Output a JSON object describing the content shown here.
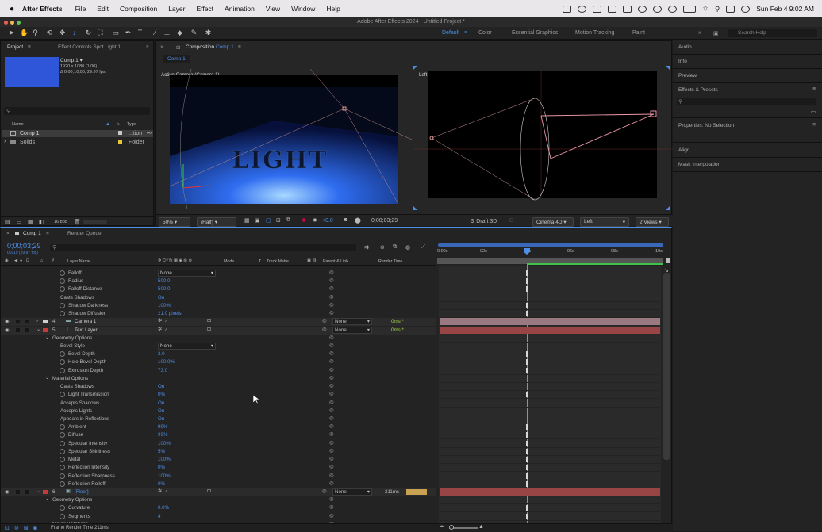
{
  "menubar": {
    "app": "After Effects",
    "items": [
      "File",
      "Edit",
      "Composition",
      "Layer",
      "Effect",
      "Animation",
      "View",
      "Window",
      "Help"
    ],
    "clock": "Sun Feb 4  9:02 AM"
  },
  "window_title": "Adobe After Effects 2024 - Untitled Project *",
  "workspaces": [
    "Default",
    "Color",
    "Essential Graphics",
    "Motion Tracking",
    "Paint"
  ],
  "search_help": "Search Help",
  "project": {
    "tab": "Project",
    "effect_tab": "Effect Controls Spot Light 1",
    "comp_name": "Comp 1 ▾",
    "comp_res": "1920 x 1080 (1.00)",
    "comp_dur": "Δ 0;00;10;00, 29.97 fps",
    "col_name": "Name",
    "col_type": "Type",
    "items": [
      {
        "name": "Comp 1",
        "type": "...tion"
      },
      {
        "name": "Solids",
        "type": "Folder"
      }
    ],
    "bpc": "16 bpc"
  },
  "composition": {
    "tab": "Composition",
    "tab_comp": "Comp 1",
    "crumb": "Comp 1",
    "view_left": "Active Camera (Camera 1)",
    "view_right": "Left",
    "logo_text": "LIGHT",
    "zoom": "50%",
    "resolution": "(Half)",
    "exposure": "+0.0",
    "timecode": "0;00;03;29",
    "draft": "Draft 3D",
    "renderer": "Cinema 4D",
    "view3d": "Left",
    "views": "2 Views"
  },
  "right_panels": [
    "Audio",
    "Info",
    "Preview",
    "Effects & Presets",
    "Properties: No Selection",
    "Align",
    "Mask Interpolation"
  ],
  "timeline": {
    "tab": "Comp 1",
    "render_queue": "Render Queue",
    "timecode": "0;00;03;29",
    "fps_sub": "00119 (29.97 fps)",
    "col_layer": "Layer Name",
    "col_mode": "Mode",
    "col_t": "T",
    "col_matte": "Track Matte",
    "col_parent": "Parent & Link",
    "col_render": "Render Time",
    "ruler": [
      "0:00s",
      "02s",
      "04s",
      "06s",
      "08s",
      "10s"
    ],
    "footer": "Frame Render Time  211ms",
    "rows": [
      {
        "label": "Falloff",
        "val": "None",
        "kind": "sel",
        "indent": 2
      },
      {
        "label": "Radius",
        "val": "500.0",
        "kind": "num",
        "indent": 2
      },
      {
        "label": "Falloff Distance",
        "val": "500.0",
        "kind": "num",
        "indent": 2
      },
      {
        "label": "Casts Shadows",
        "val": "On",
        "kind": "num",
        "indent": 1
      },
      {
        "label": "Shadow Darkness",
        "val": "100%",
        "kind": "num",
        "indent": 2
      },
      {
        "label": "Shadow Diffusion",
        "val": "21.0 pixels",
        "kind": "num",
        "indent": 2
      },
      {
        "label": "Camera 1",
        "num": "4",
        "kind": "layer",
        "color": "#cfcfcf",
        "parent": "None",
        "render": "0ms *"
      },
      {
        "label": "Text Layer",
        "num": "5",
        "kind": "layer",
        "color": "#c23b3b",
        "parent": "None",
        "render": "0ms *"
      },
      {
        "label": "Geometry Options",
        "kind": "group",
        "indent": 1
      },
      {
        "label": "Bevel Style",
        "val": "None",
        "kind": "sel",
        "indent": 1
      },
      {
        "label": "Bevel Depth",
        "val": "2.0",
        "kind": "num",
        "indent": 2
      },
      {
        "label": "Hole Bevel Depth",
        "val": "100.0%",
        "kind": "num",
        "indent": 2
      },
      {
        "label": "Extrusion Depth",
        "val": "73.0",
        "kind": "num",
        "indent": 2
      },
      {
        "label": "Material Options",
        "kind": "group",
        "indent": 1
      },
      {
        "label": "Casts Shadows",
        "val": "On",
        "kind": "num",
        "indent": 1
      },
      {
        "label": "Light Transmission",
        "val": "0%",
        "kind": "num",
        "indent": 2
      },
      {
        "label": "Accepts Shadows",
        "val": "On",
        "kind": "num",
        "indent": 1
      },
      {
        "label": "Accepts Lights",
        "val": "On",
        "kind": "num",
        "indent": 1
      },
      {
        "label": "Appears in Reflections",
        "val": "On",
        "kind": "num",
        "indent": 1
      },
      {
        "label": "Ambient",
        "val": "99%",
        "kind": "num",
        "indent": 2
      },
      {
        "label": "Diffuse",
        "val": "99%",
        "kind": "num",
        "indent": 2
      },
      {
        "label": "Specular Intensity",
        "val": "100%",
        "kind": "num",
        "indent": 2
      },
      {
        "label": "Specular Shininess",
        "val": "5%",
        "kind": "num",
        "indent": 2
      },
      {
        "label": "Metal",
        "val": "100%",
        "kind": "num",
        "indent": 2
      },
      {
        "label": "Reflection Intensity",
        "val": "0%",
        "kind": "num",
        "indent": 2
      },
      {
        "label": "Reflection Sharpness",
        "val": "100%",
        "kind": "num",
        "indent": 2
      },
      {
        "label": "Reflection Rolloff",
        "val": "0%",
        "kind": "num",
        "indent": 2
      },
      {
        "label": "[Floor]",
        "num": "6",
        "kind": "layer",
        "color": "#c23b3b",
        "parent": "None",
        "render": "211ms"
      },
      {
        "label": "Geometry Options",
        "kind": "group",
        "indent": 1
      },
      {
        "label": "Curvature",
        "val": "0.0%",
        "kind": "num",
        "indent": 2
      },
      {
        "label": "Segments",
        "val": "4",
        "kind": "num",
        "indent": 2
      },
      {
        "label": "Material Options",
        "kind": "group",
        "indent": 1
      }
    ]
  }
}
